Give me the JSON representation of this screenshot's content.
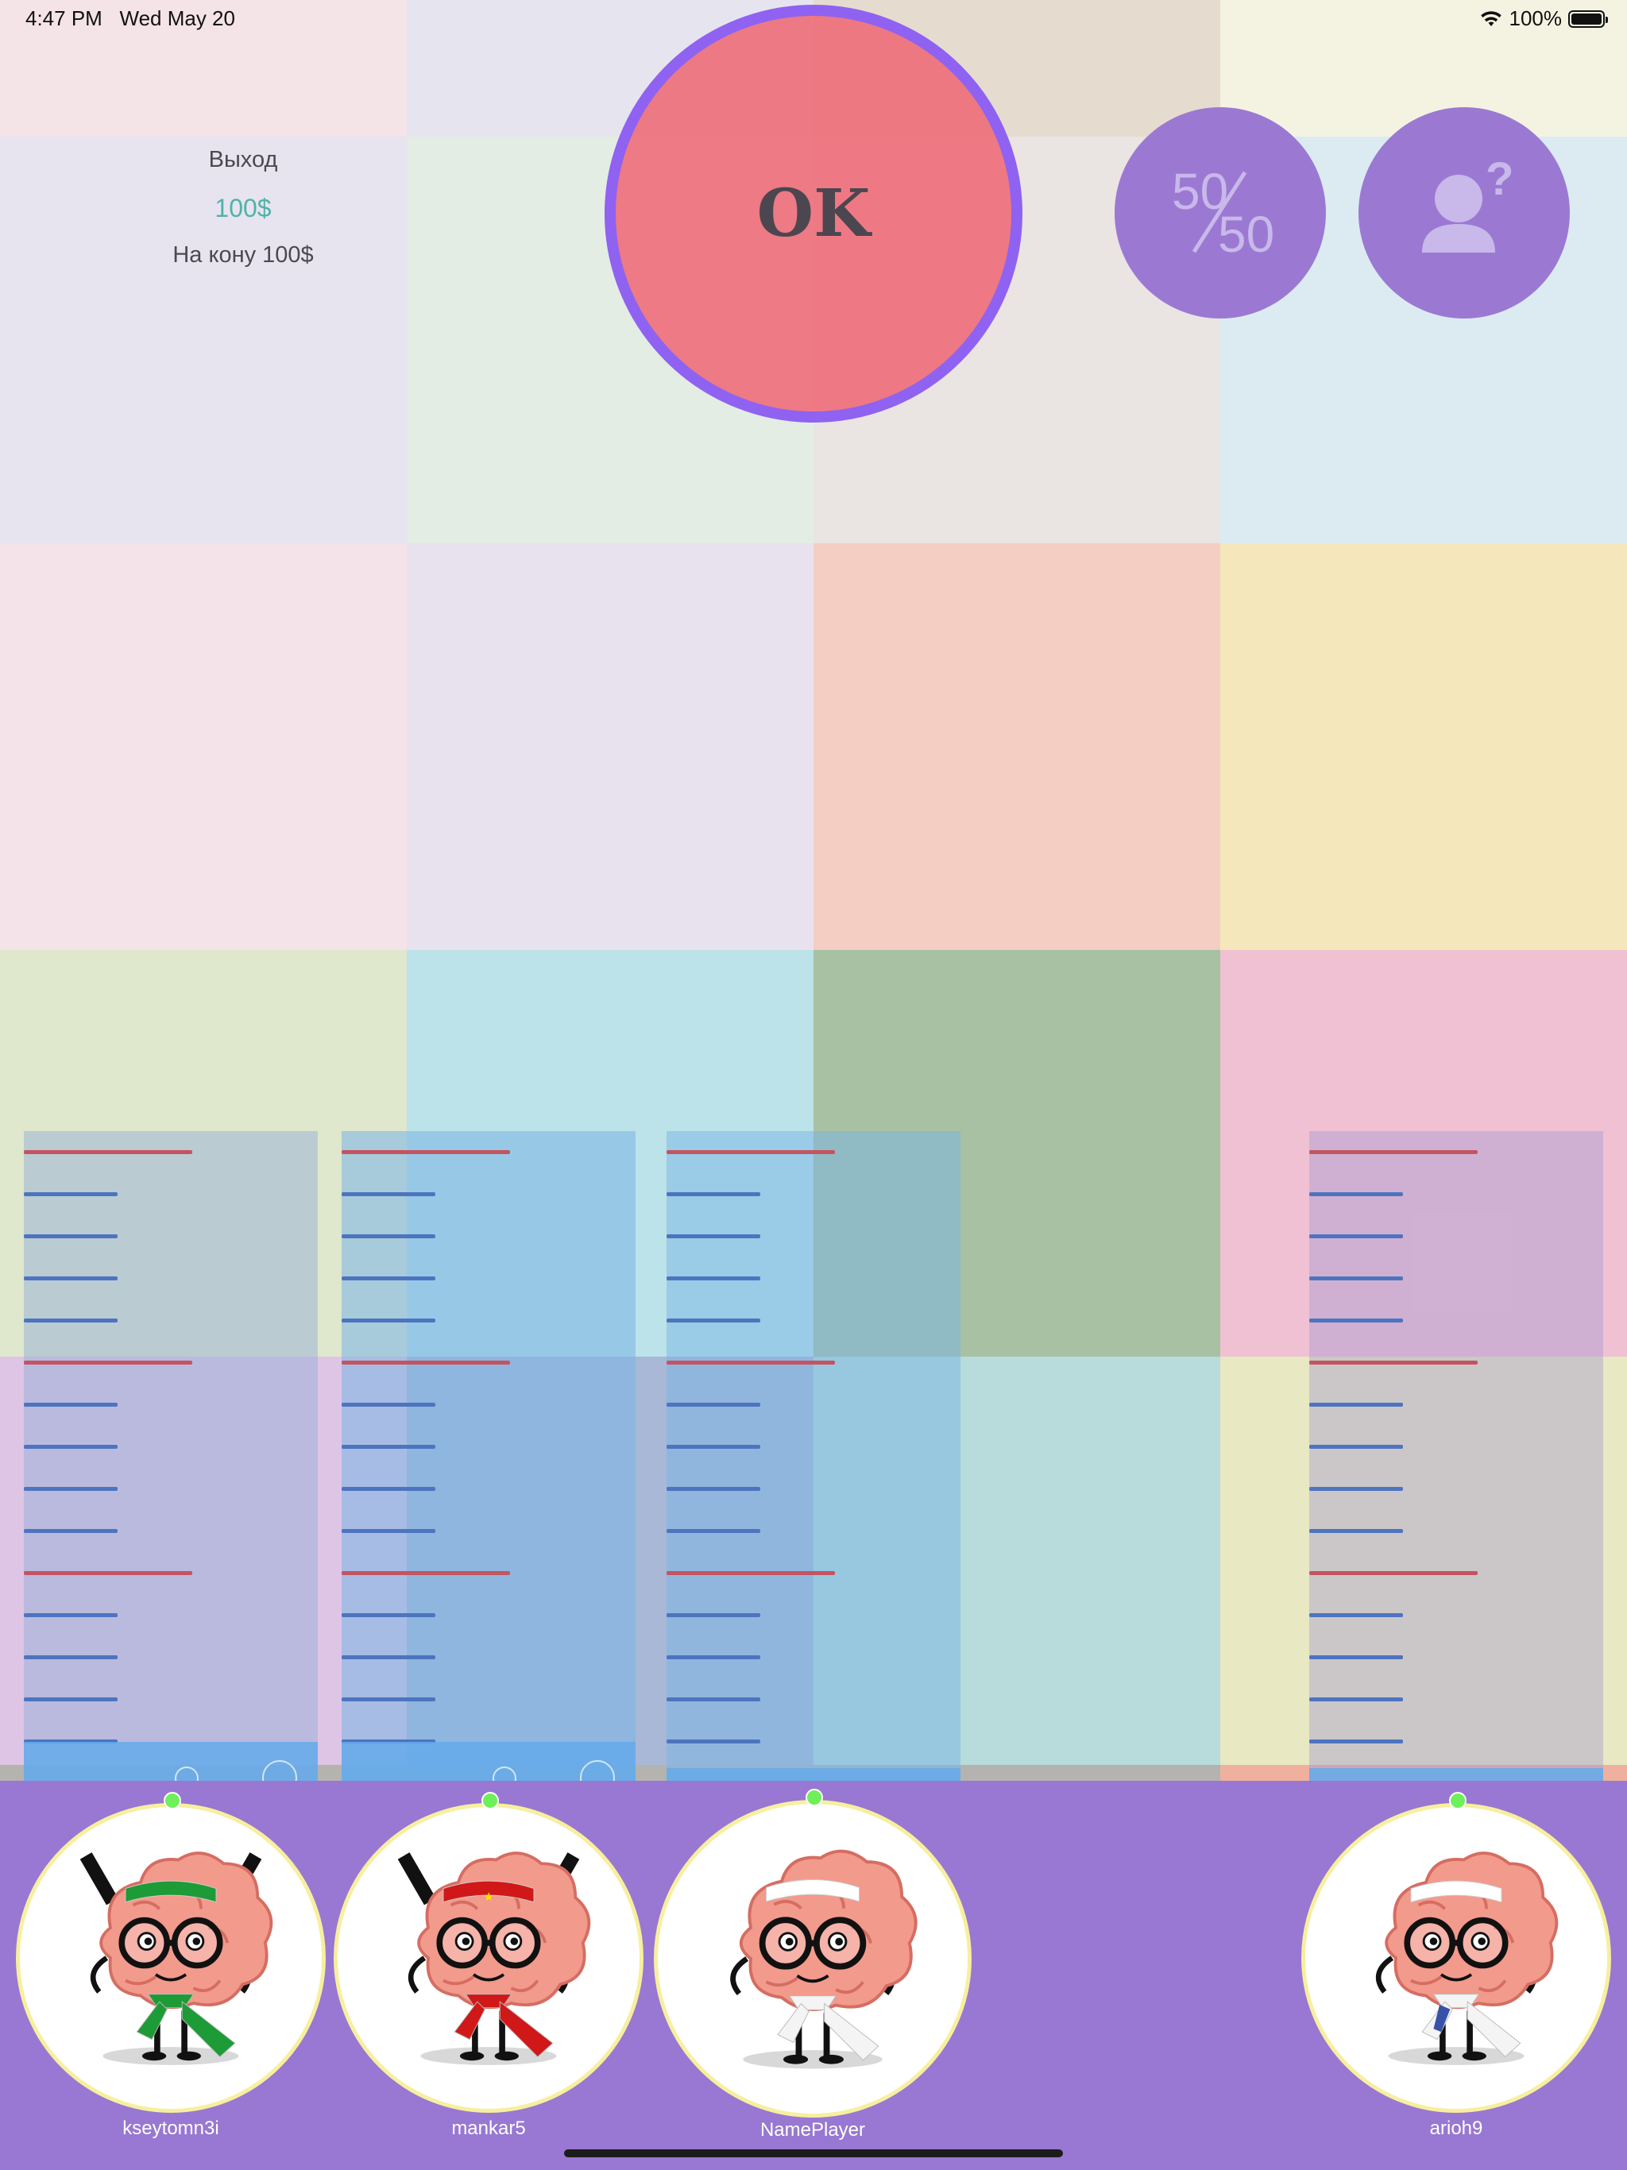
{
  "status_bar": {
    "time": "4:47 PM",
    "date": "Wed May 20",
    "battery_percent": "100%",
    "wifi_icon": "wifi-icon",
    "battery_icon": "battery-full-icon"
  },
  "game_info": {
    "exit_label": "Выход",
    "money": "100$",
    "stake": "На кону 100$"
  },
  "ok_button": {
    "label": "OK"
  },
  "lifelines": {
    "fifty_fifty": {
      "icon": "fifty-fifty-icon",
      "top_text": "50",
      "bottom_text": "50"
    },
    "ask_audience": {
      "icon": "person-question-icon"
    }
  },
  "players": [
    {
      "name": "kseytomn3i",
      "accessory": "green",
      "water_level": 0.06,
      "online": true
    },
    {
      "name": "mankar5",
      "accessory": "red",
      "water_level": 0.06,
      "online": true
    },
    {
      "name": "NamePlayer",
      "accessory": "white",
      "water_level": 0.02,
      "online": true
    },
    {
      "name": "arioh9",
      "accessory": "white-blue-tie",
      "water_level": 0.02,
      "online": true
    }
  ],
  "colors": {
    "player_bar": "#9878d2",
    "ok_border": "#8f62f1",
    "ok_fill": "#ee707c",
    "lifeline_fill": "#9b79d3",
    "money_text": "#4fb3a9",
    "scale_red": "#c45460",
    "scale_blue": "#4d74bf",
    "online_dot": "#6fef5a"
  }
}
